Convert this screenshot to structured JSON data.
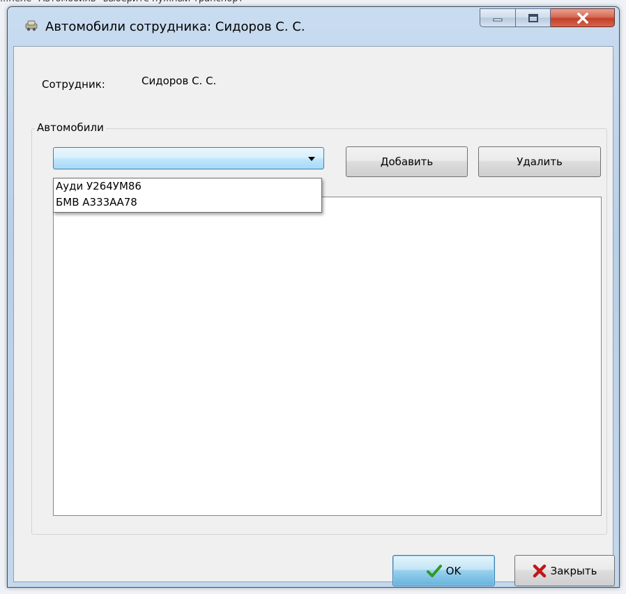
{
  "top_caption": "...пеле \"Автомобиль\" выберите нужный транспорт",
  "window": {
    "title": "Автомобили сотрудника: Сидоров С. С."
  },
  "employee": {
    "label": "Сотрудник:",
    "value": "Сидоров С. С."
  },
  "cars_group": {
    "title": "Автомобили",
    "combo_value": "",
    "dropdown_items": [
      "Ауди У264УМ86",
      "БМВ А333АА78"
    ],
    "add_label": "Добавить",
    "delete_label": "Удалить",
    "list_items": []
  },
  "footer": {
    "ok_label": "OK",
    "close_label": "Закрыть"
  },
  "icons": {
    "ok": "checkmark-icon",
    "close": "red-x-icon",
    "app": "car-app-icon"
  },
  "colors": {
    "ok_check": "#2f9a1f",
    "close_x": "#c01818",
    "combo_highlight": "#a7d9f5"
  }
}
